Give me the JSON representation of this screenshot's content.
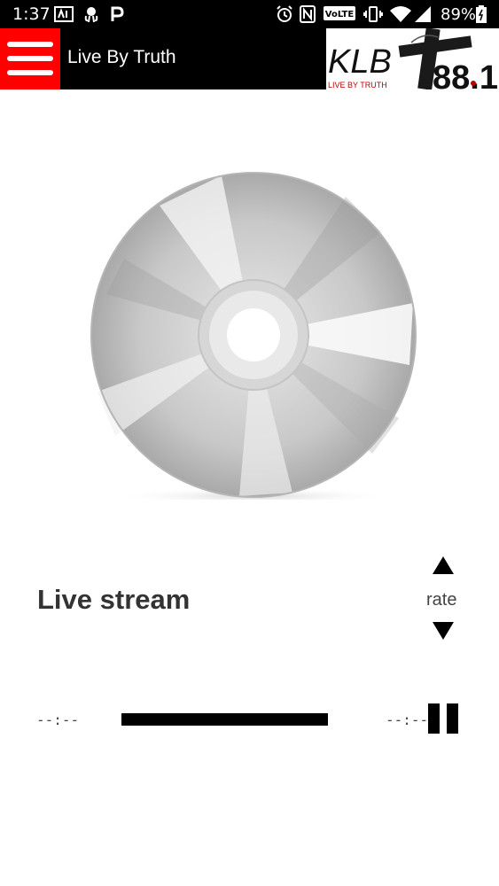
{
  "status_bar": {
    "time": "1:37",
    "battery": "89%",
    "icons": [
      "app-icon",
      "octopus-icon",
      "p-icon",
      "alarm-icon",
      "nfc-icon",
      "volte-icon",
      "vibrate-icon",
      "wifi-icon",
      "signal-icon",
      "battery-icon"
    ]
  },
  "app_bar": {
    "title": "Live By Truth",
    "logo_text": "KLB",
    "logo_number": "88.1",
    "logo_tagline": "LIVE BY TRUTH",
    "menu_color": "#ff0000"
  },
  "player": {
    "title": "Live stream",
    "rate_label": "rate",
    "rate_up": "▲",
    "rate_down": "▼",
    "time_elapsed": "--:--",
    "time_remaining": "--:--",
    "progress": 0
  }
}
